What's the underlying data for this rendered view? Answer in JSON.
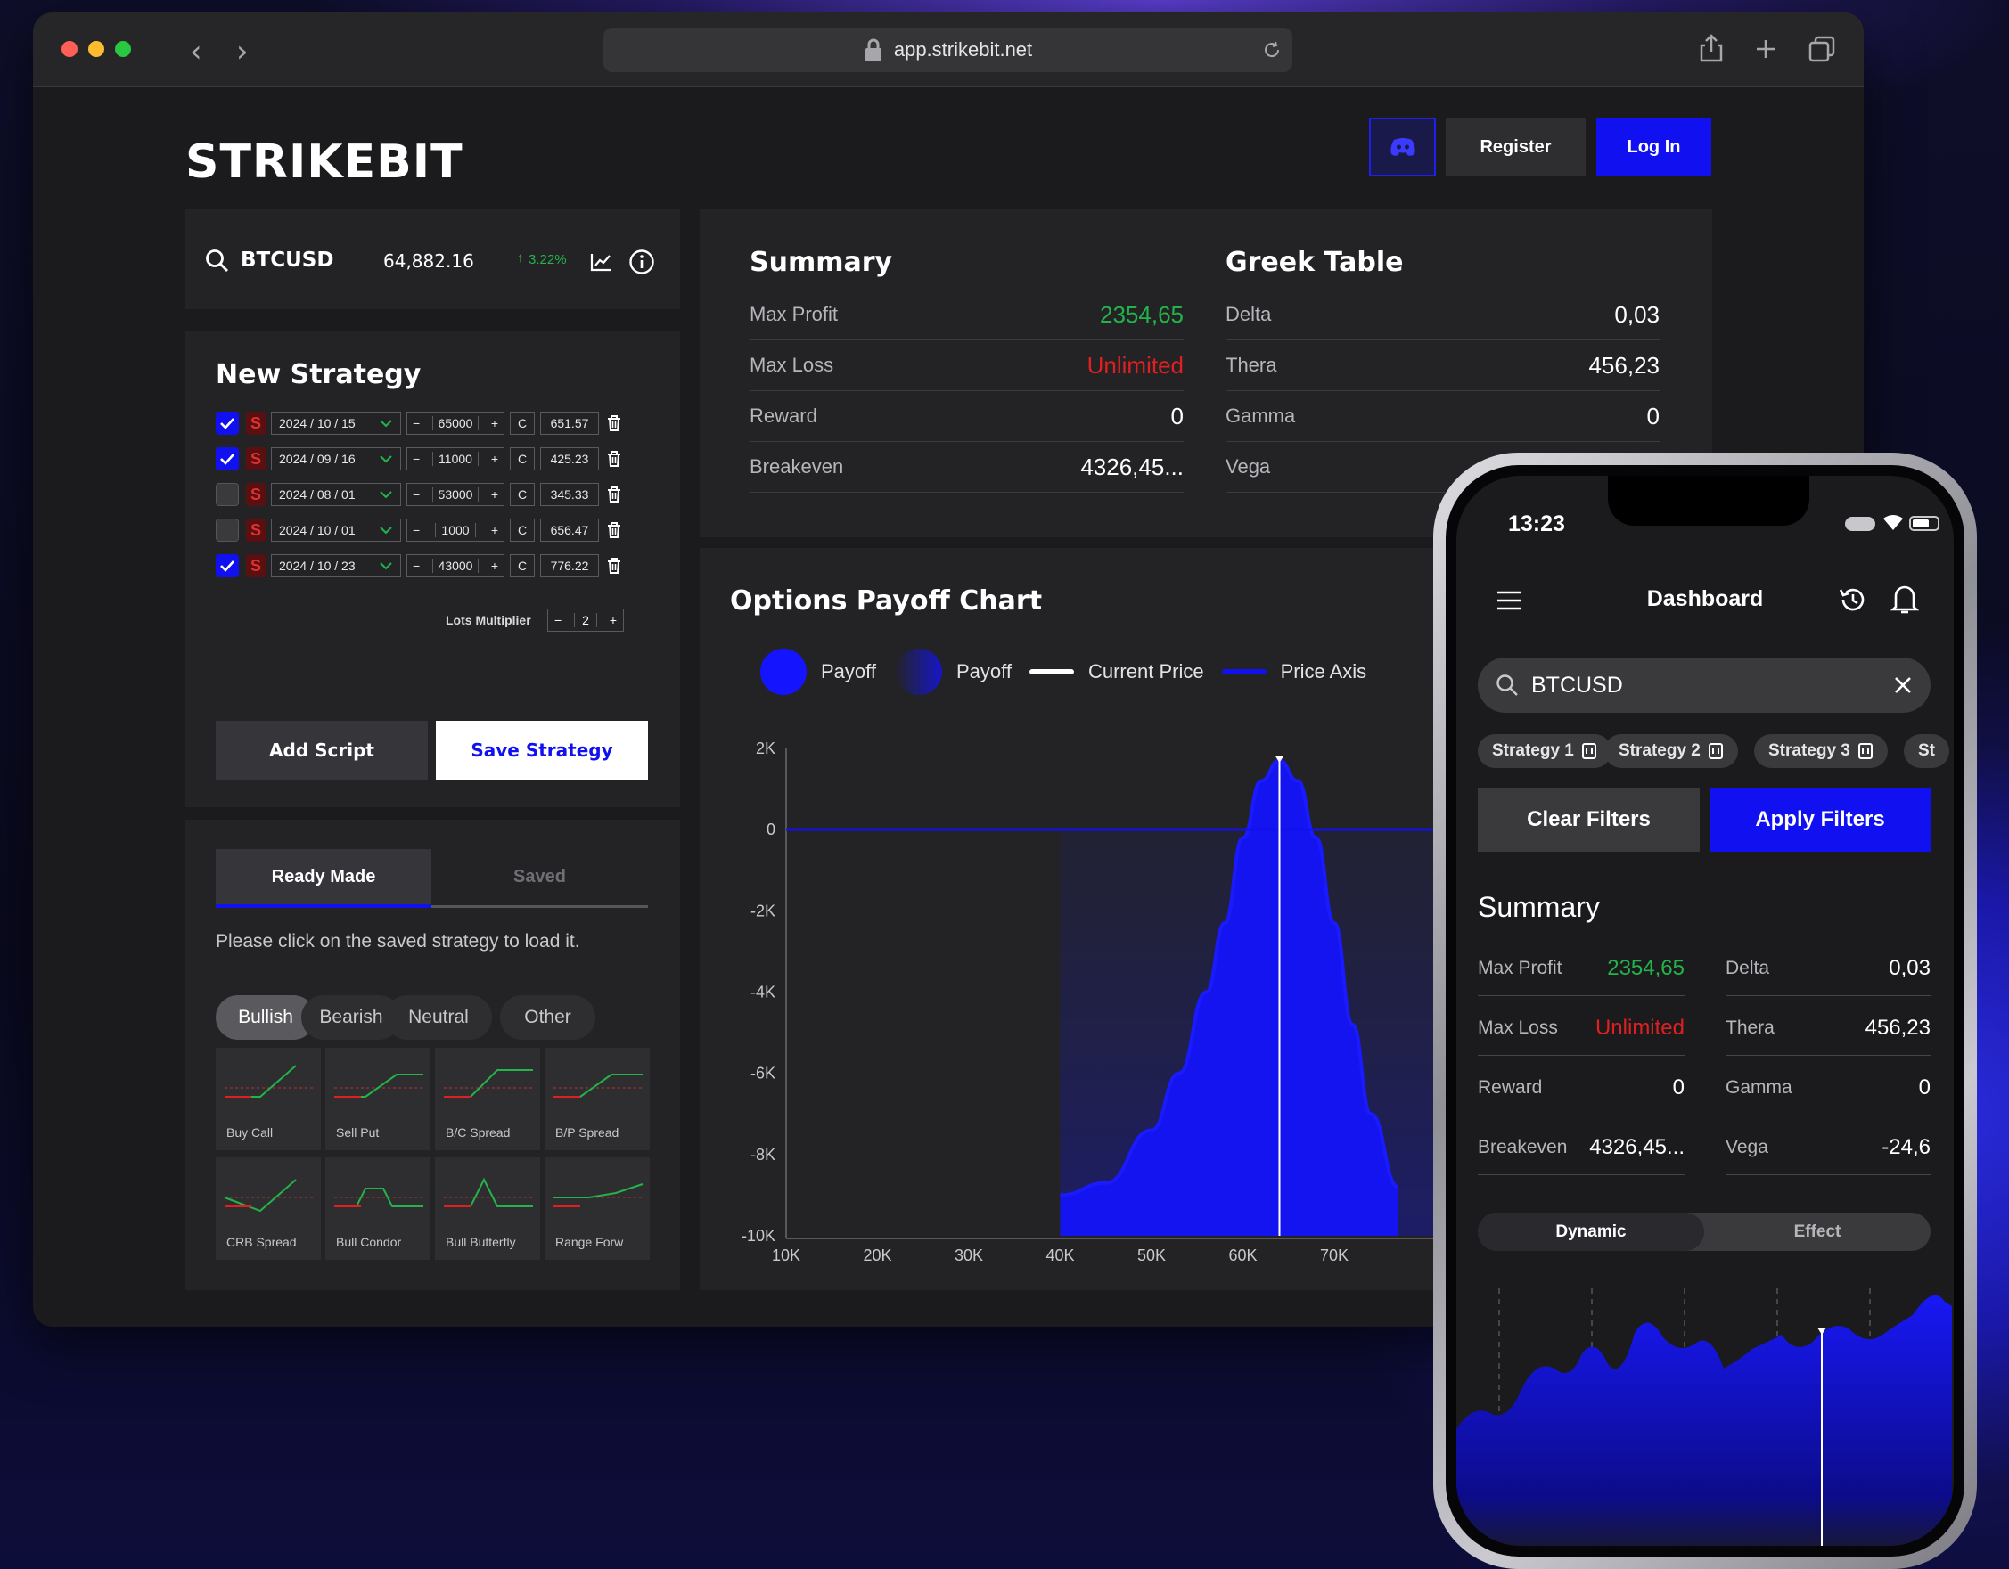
{
  "browser": {
    "url": "app.strikebit.net"
  },
  "header": {
    "logo": "STRIKEBIT",
    "register_label": "Register",
    "login_label": "Log In"
  },
  "ticker": {
    "symbol": "BTCUSD",
    "price": "64,882.16",
    "change": "3.22%"
  },
  "strategy": {
    "title": "New Strategy",
    "legs": [
      {
        "checked": true,
        "date": "2024 / 10 / 15",
        "strike": "65000",
        "type": "C",
        "premium": "651.57"
      },
      {
        "checked": true,
        "date": "2024 / 09 / 16",
        "strike": "11000",
        "type": "C",
        "premium": "425.23"
      },
      {
        "checked": false,
        "date": "2024 / 08 / 01",
        "strike": "53000",
        "type": "C",
        "premium": "345.33"
      },
      {
        "checked": false,
        "date": "2024 / 10 / 01",
        "strike": "1000",
        "type": "C",
        "premium": "656.47"
      },
      {
        "checked": true,
        "date": "2024 / 10 / 23",
        "strike": "43000",
        "type": "C",
        "premium": "776.22"
      }
    ],
    "side_label": "S",
    "lots_label": "Lots Multiplier",
    "lots_value": "2",
    "add_script_label": "Add Script",
    "save_strategy_label": "Save Strategy"
  },
  "readymade": {
    "tab_ready": "Ready Made",
    "tab_saved": "Saved",
    "hint": "Please click on the saved strategy to load it.",
    "filters": [
      "Bullish",
      "Bearish",
      "Neutral",
      "Other"
    ],
    "tiles": [
      "Buy Call",
      "Sell Put",
      "B/C Spread",
      "B/P Spread",
      "CRB Spread",
      "Bull Condor",
      "Bull Butterfly",
      "Range Forw"
    ]
  },
  "summary": {
    "title": "Summary",
    "rows": [
      {
        "label": "Max Profit",
        "value": "2354,65"
      },
      {
        "label": "Max Loss",
        "value": "Unlimited"
      },
      {
        "label": "Reward",
        "value": "0"
      },
      {
        "label": "Breakeven",
        "value": "4326,45..."
      }
    ]
  },
  "greek": {
    "title": "Greek Table",
    "rows": [
      {
        "label": "Delta",
        "value": "0,03"
      },
      {
        "label": "Thera",
        "value": "456,23"
      },
      {
        "label": "Gamma",
        "value": "0"
      },
      {
        "label": "Vega",
        "value": ""
      }
    ]
  },
  "colors": {
    "accent": "#1010f0",
    "profit": "#22b34a",
    "loss": "#e02020"
  },
  "chart_data": {
    "type": "area",
    "title": "Options Payoff Chart",
    "legend": [
      "Payoff",
      "Payoff",
      "Current Price",
      "Price Axis"
    ],
    "x_ticks": [
      "10K",
      "20K",
      "30K",
      "40K",
      "50K",
      "60K",
      "70K"
    ],
    "y_ticks": [
      "2K",
      "0",
      "-2K",
      "-4K",
      "-6K",
      "-8K",
      "-10K"
    ],
    "ylim": [
      -10000,
      2000
    ],
    "current_price": 64000,
    "x": [
      40000,
      45000,
      50000,
      53000,
      56000,
      58000,
      60000,
      62000,
      64000,
      66000,
      68000,
      70000,
      72000,
      74000,
      77000
    ],
    "y": [
      -9000,
      -8700,
      -7400,
      -6000,
      -4000,
      -2300,
      -200,
      1200,
      1700,
      1200,
      -200,
      -2300,
      -4800,
      -7000,
      -8800
    ]
  },
  "mobile": {
    "time": "13:23",
    "title": "Dashboard",
    "search_value": "BTCUSD",
    "chips": [
      "Strategy 1",
      "Strategy 2",
      "Strategy 3",
      "St"
    ],
    "clear_label": "Clear Filters",
    "apply_label": "Apply Filters",
    "summary_title": "Summary",
    "left_rows": [
      {
        "label": "Max Profit",
        "value": "2354,65"
      },
      {
        "label": "Max Loss",
        "value": "Unlimited"
      },
      {
        "label": "Reward",
        "value": "0"
      },
      {
        "label": "Breakeven",
        "value": "4326,45..."
      }
    ],
    "right_rows": [
      {
        "label": "Delta",
        "value": "0,03"
      },
      {
        "label": "Thera",
        "value": "456,23"
      },
      {
        "label": "Gamma",
        "value": "0"
      },
      {
        "label": "Vega",
        "value": "-24,6"
      }
    ],
    "toggle_dynamic": "Dynamic",
    "toggle_effect": "Effect"
  }
}
